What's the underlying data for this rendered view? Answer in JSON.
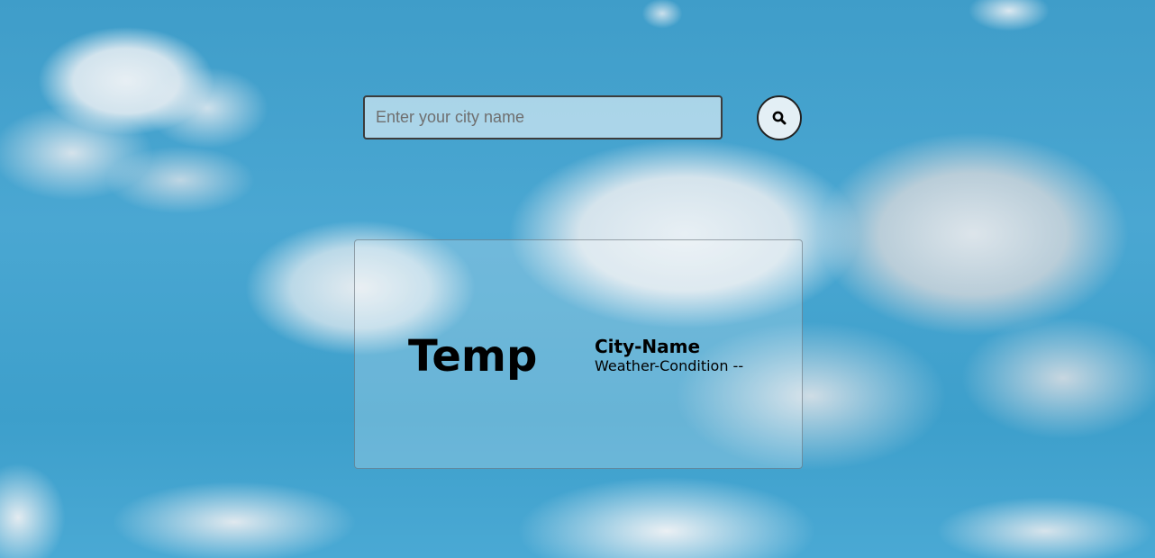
{
  "search": {
    "placeholder": "Enter your city name",
    "value": "",
    "button_icon": "search-icon"
  },
  "weather": {
    "temp": "Temp",
    "city_name": "City-Name",
    "condition": "Weather-Condition --"
  },
  "colors": {
    "sky": "#4aa7d2",
    "text": "#000000"
  }
}
